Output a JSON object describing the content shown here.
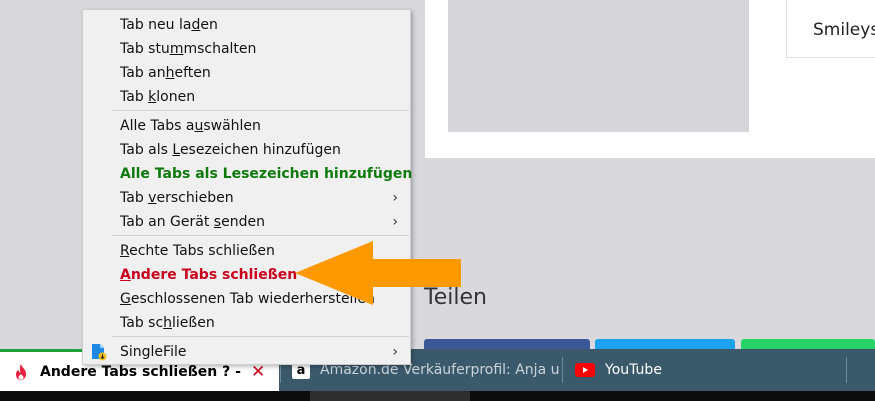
{
  "background_page": {
    "smileys_label": "Smileys",
    "share_title": "Teilen"
  },
  "context_menu": {
    "items": [
      {
        "pre": "Tab neu la",
        "u": "d",
        "post": "en"
      },
      {
        "pre": "Tab stu",
        "u": "m",
        "post": "mschalten"
      },
      {
        "pre": "Tab an",
        "u": "h",
        "post": "eften"
      },
      {
        "pre": "Tab ",
        "u": "k",
        "post": "lonen"
      },
      {
        "pre": "Alle Tabs a",
        "u": "u",
        "post": "swählen"
      },
      {
        "pre": "Tab als ",
        "u": "L",
        "post": "esezeichen hinzufügen"
      },
      {
        "pre": "",
        "u": "",
        "post": "Alle Tabs als Lesezeichen hinzufügen"
      },
      {
        "pre": "Tab ",
        "u": "v",
        "post": "erschieben"
      },
      {
        "pre": "Tab an Gerät ",
        "u": "s",
        "post": "enden"
      },
      {
        "pre": "",
        "u": "R",
        "post": "echte Tabs schließen"
      },
      {
        "pre": "",
        "u": "A",
        "post": "ndere Tabs schließen"
      },
      {
        "pre": "",
        "u": "G",
        "post": "eschlossenen Tab wiederherstellen"
      },
      {
        "pre": "Tab sc",
        "u": "h",
        "post": "ließen"
      },
      {
        "pre": "",
        "u": "",
        "post": "SingleFile"
      }
    ],
    "submenu_arrow": "›"
  },
  "tabs": [
    {
      "title": "Andere Tabs schließen ? - Ind",
      "close": "✕",
      "icon": "fire-icon"
    },
    {
      "title": "Amazon.de Verkäuferprofil: Anja u",
      "icon": "amazon-icon",
      "icon_glyph": "a"
    },
    {
      "title": "YouTube",
      "icon": "youtube-icon"
    }
  ],
  "colors": {
    "accent_green": "#0c7a0c",
    "accent_red": "#c8001e",
    "arrow_orange": "#ff9900",
    "tabbar": "#3a5a6c"
  }
}
